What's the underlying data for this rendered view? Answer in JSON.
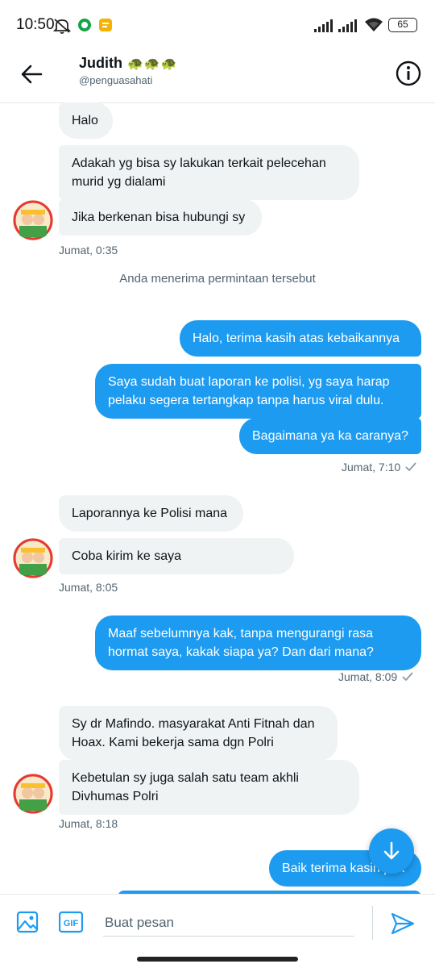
{
  "status_bar": {
    "time": "10:50",
    "battery": "65",
    "icons": [
      "mute-icon",
      "app-notification-icon",
      "app-notification-icon-2",
      "signal-icon",
      "signal-icon-2",
      "wifi-icon",
      "battery-icon"
    ]
  },
  "header": {
    "name": "Judith",
    "name_emoji": "🐢🐢🐢",
    "handle": "@penguasahati",
    "back_icon": "back-arrow-icon",
    "info_icon": "info-icon"
  },
  "messages": [
    {
      "dir": "in",
      "text": "Halo"
    },
    {
      "dir": "in",
      "text": "Adakah yg bisa sy lakukan terkait pelecehan murid yg dialami"
    },
    {
      "dir": "in",
      "text": "Jika berkenan bisa hubungi sy"
    },
    {
      "dir": "out",
      "text": "Halo, terima kasih atas kebaikannya"
    },
    {
      "dir": "out",
      "text": "Saya sudah buat laporan ke polisi, yg saya harap pelaku segera tertangkap tanpa harus viral dulu."
    },
    {
      "dir": "out",
      "text": "Bagaimana ya ka caranya?"
    },
    {
      "dir": "in",
      "text": "Laporannya ke Polisi mana"
    },
    {
      "dir": "in",
      "text": "Coba kirim ke saya"
    },
    {
      "dir": "out",
      "text": "Maaf sebelumnya kak, tanpa mengurangi rasa hormat saya, kakak siapa ya? Dan dari mana?"
    },
    {
      "dir": "in",
      "text": "Sy dr Mafindo. masyarakat Anti Fitnah dan Hoax. Kami bekerja sama dgn Polri"
    },
    {
      "dir": "in",
      "text": "Kebetulan sy juga salah satu team akhli Divhumas Polri"
    },
    {
      "dir": "out",
      "text": "Baik terima kasih pak"
    }
  ],
  "timestamps": [
    "Jumat, 0:35",
    "Jumat, 7:10",
    "Jumat, 8:05",
    "Jumat, 8:09",
    "Jumat, 8:18"
  ],
  "notice": "Anda menerima permintaan tersebut",
  "composer": {
    "placeholder": "Buat pesan",
    "gif_label": "GIF",
    "image_icon": "image-icon",
    "send_icon": "send-icon"
  },
  "fab_icon": "arrow-down-icon",
  "colors": {
    "accent": "#1d9bf0",
    "incoming_bg": "#eff3f4",
    "muted_text": "#536471"
  }
}
